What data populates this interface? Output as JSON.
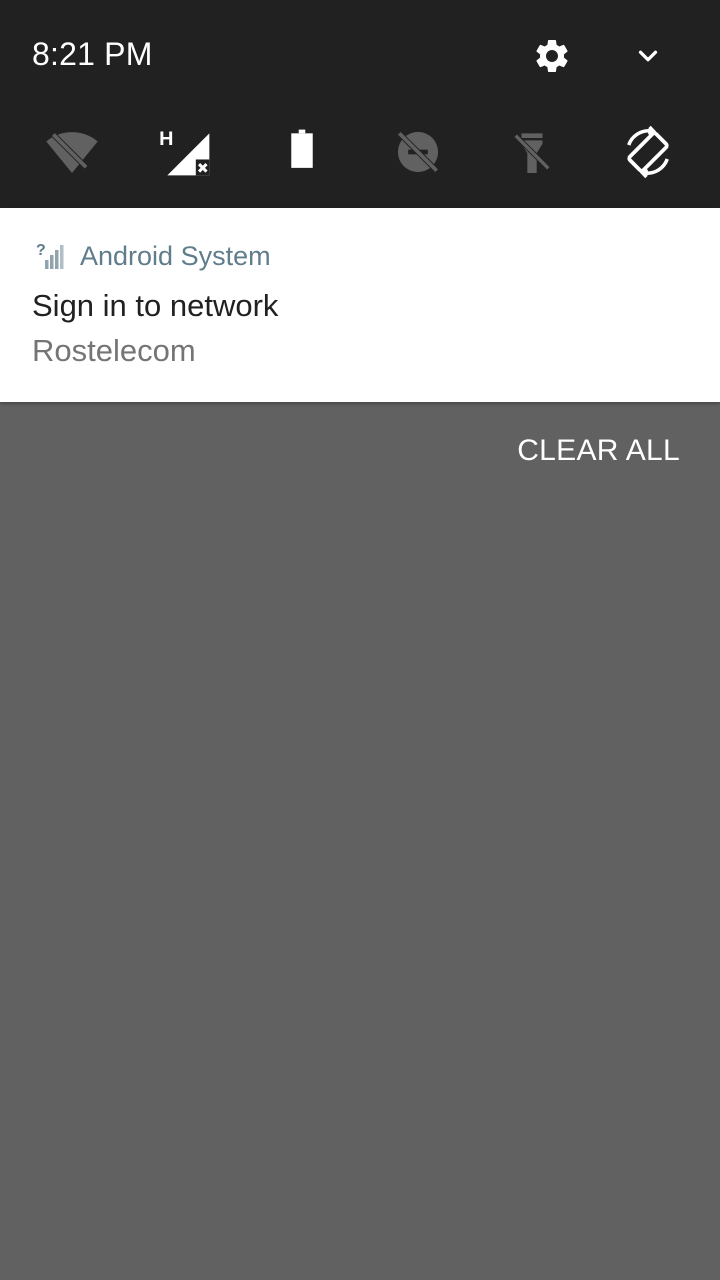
{
  "status": {
    "time": "8:21 PM"
  },
  "header": {
    "settings_icon": "gear-icon",
    "expand_icon": "chevron-down-icon"
  },
  "quick_tiles": [
    {
      "name": "wifi-off-icon",
      "state": "off"
    },
    {
      "name": "cellular-h-no-signal-icon",
      "badge": "H",
      "state": "on"
    },
    {
      "name": "battery-icon",
      "state": "on"
    },
    {
      "name": "do-not-disturb-off-icon",
      "state": "off"
    },
    {
      "name": "flashlight-off-icon",
      "state": "off"
    },
    {
      "name": "auto-rotate-icon",
      "state": "on"
    }
  ],
  "notification": {
    "app_icon": "signal-unknown-icon",
    "app_name": "Android System",
    "title": "Sign in to network",
    "text": "Rostelecom"
  },
  "actions": {
    "clear_all": "CLEAR ALL"
  },
  "colors": {
    "panel_bg": "#212121",
    "scrim": "#616161",
    "tile_active": "#ffffff",
    "tile_inactive": "#616161",
    "app_name": "#607d8b"
  }
}
